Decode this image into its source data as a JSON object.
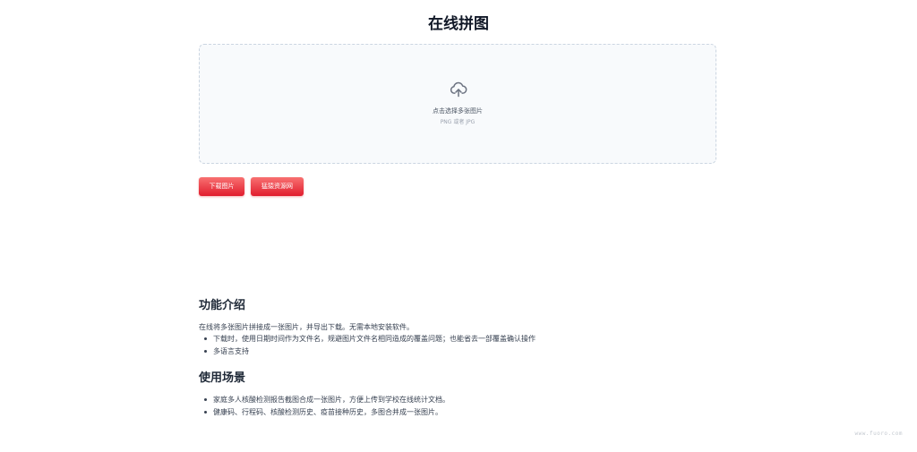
{
  "page": {
    "title": "在线拼图"
  },
  "upload": {
    "prompt": "点击选择多张图片",
    "formats": "PNG 或者 JPG",
    "icon": "cloud-upload-icon"
  },
  "actions": {
    "download_label": "下载图片",
    "source_label": "猛猿资源网",
    "button_color": "#e11d2e"
  },
  "intro": {
    "heading": "功能介绍",
    "summary": "在线将多张图片拼接成一张图片，并导出下载。无需本地安装软件。",
    "items": [
      "下载时，使用日期时间作为文件名，规避图片文件名相同造成的覆盖问题；也能省去一部覆盖确认操作",
      "多语言支持"
    ]
  },
  "usage": {
    "heading": "使用场景",
    "items": [
      "家庭多人核酸检测报告截图合成一张图片，方便上传到学校在线统计文档。",
      "健康码、行程码、核酸检测历史、疫苗接种历史，多图合并成一张图片。"
    ]
  },
  "footer": {
    "watermark": "www.fuoro.com"
  }
}
